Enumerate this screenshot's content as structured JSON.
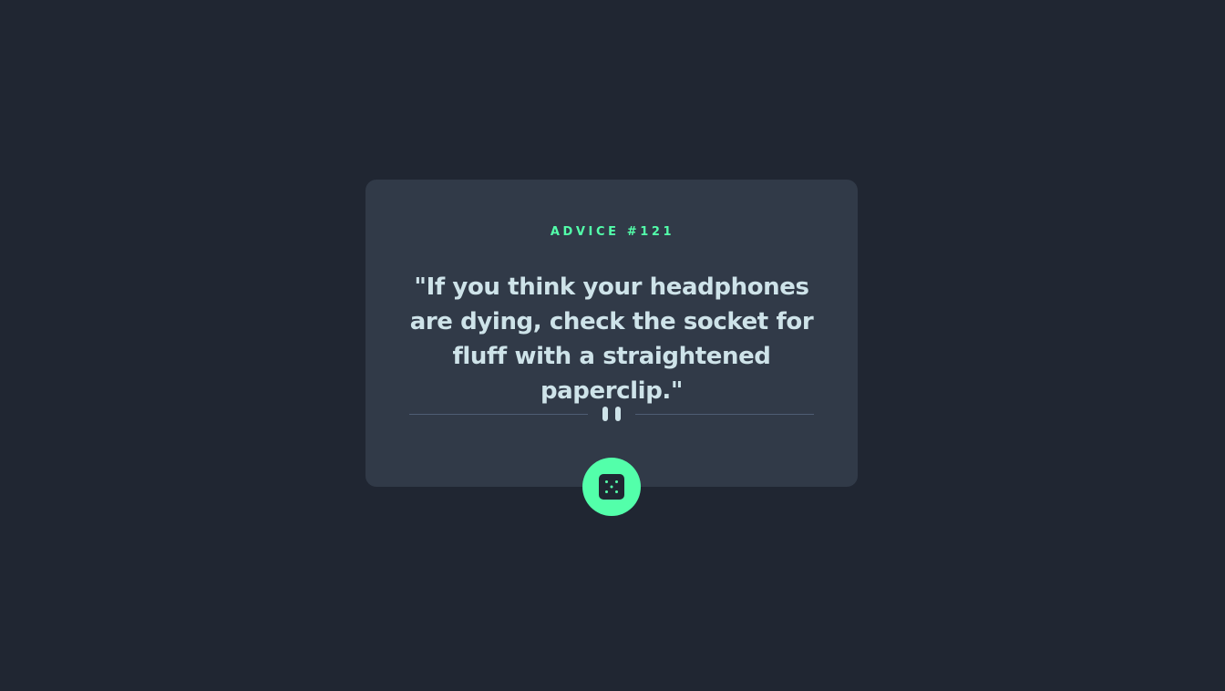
{
  "advice": {
    "label": "ADVICE",
    "number": "#121",
    "text": "\"If you think your headphones are dying, check the socket for fluff with a straightened paperclip.\""
  },
  "icons": {
    "divider": "pause-icon",
    "button": "dice-icon"
  },
  "colors": {
    "background": "#202632",
    "card": "#313a48",
    "accent": "#53ffaa",
    "text": "#cee3e9",
    "divider": "#4f5d74"
  }
}
